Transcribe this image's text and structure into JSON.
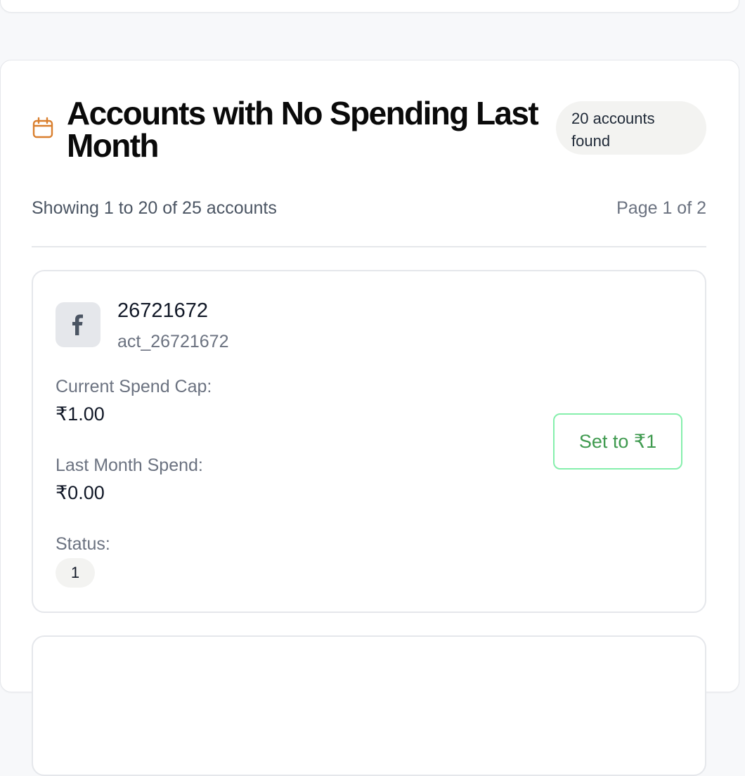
{
  "header": {
    "icon": "calendar-icon",
    "title": "Accounts with No Spending Last Month",
    "badge": "20 accounts found"
  },
  "summary": {
    "showing": "Showing 1 to 20 of 25 accounts",
    "page": "Page 1 of 2"
  },
  "accounts": [
    {
      "platform_icon": "facebook-icon",
      "name": "26721672",
      "id": "act_26721672",
      "spend_cap_label": "Current Spend Cap:",
      "spend_cap": "₹1.00",
      "last_spend_label": "Last Month Spend:",
      "last_spend": "₹0.00",
      "status_label": "Status:",
      "status": "1",
      "action": "Set to ₹1"
    }
  ],
  "colors": {
    "accent_orange": "#d97f2e",
    "button_green": "#3f9a4f",
    "button_border": "#86efac"
  }
}
